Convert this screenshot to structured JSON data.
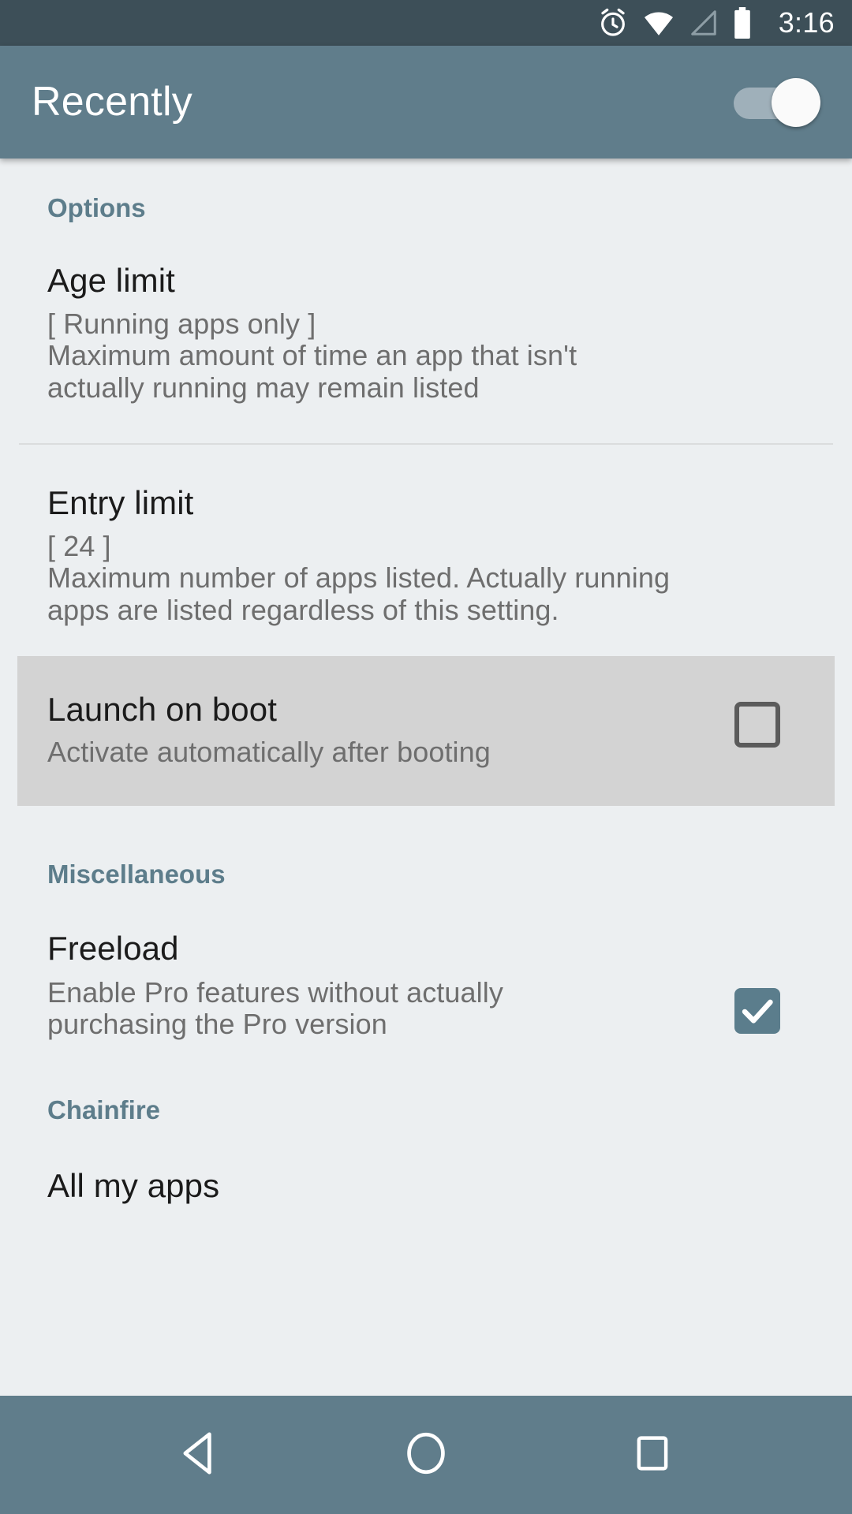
{
  "status_bar": {
    "time": "3:16",
    "icons": [
      "alarm-icon",
      "wifi-icon",
      "signal-icon",
      "battery-icon"
    ],
    "background_color": "#3d4f58"
  },
  "app_bar": {
    "title": "Recently",
    "background_color": "#607d8b",
    "toggle": {
      "name": "master-toggle",
      "state": "on",
      "track_color": "#9fb0ba",
      "thumb_color": "#fafafa"
    }
  },
  "theme": {
    "accent_color": "#5d7d8b",
    "content_background": "#eceff1",
    "highlight_row_background": "#d3d3d3",
    "title_color": "#1b1b1b",
    "summary_color": "#6e6e6e",
    "divider_color": "#dadcdd"
  },
  "sections": [
    {
      "header": "Options",
      "items": [
        {
          "title": "Age limit",
          "summary_lines": [
            "[ Running apps only ]",
            "Maximum amount of time an app that isn't",
            "actually running may remain listed"
          ],
          "control": "none",
          "highlighted": false
        },
        {
          "title": "Entry limit",
          "summary_lines": [
            "[ 24 ]",
            "Maximum number of apps listed. Actually running",
            "apps are listed regardless of this setting."
          ],
          "control": "none",
          "highlighted": false
        },
        {
          "title": "Launch on boot",
          "summary_lines": [
            "Activate automatically after booting"
          ],
          "control": "checkbox",
          "checked": false,
          "highlighted": true
        }
      ]
    },
    {
      "header": "Miscellaneous",
      "items": [
        {
          "title": "Freeload",
          "summary_lines": [
            "Enable Pro features without actually",
            "purchasing the Pro version"
          ],
          "control": "checkbox",
          "checked": true,
          "highlighted": false
        }
      ]
    },
    {
      "header": "Chainfire",
      "items": [
        {
          "title": "All my apps",
          "summary_lines": [],
          "control": "none",
          "highlighted": false
        }
      ]
    }
  ],
  "nav_bar": {
    "background_color": "#607d8b",
    "buttons": [
      {
        "name": "back-button",
        "icon": "back-triangle-icon"
      },
      {
        "name": "home-button",
        "icon": "home-circle-icon"
      },
      {
        "name": "recents-button",
        "icon": "recents-square-icon"
      }
    ]
  }
}
